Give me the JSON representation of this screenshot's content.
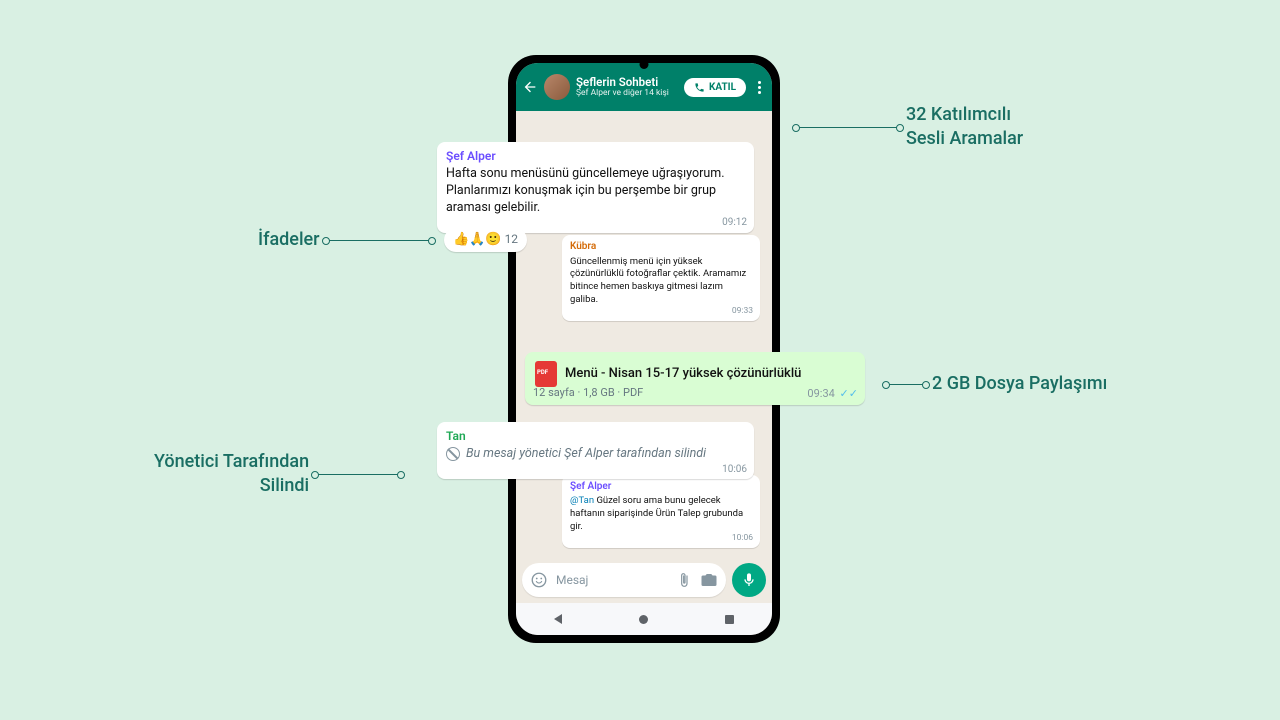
{
  "header": {
    "title": "Şeflerin Sohbeti",
    "subtitle": "Şef Alper ve diğer 14 kişi",
    "join_label": "KATIL"
  },
  "messages": {
    "m1_sender": "Şef Alper",
    "m1_text": "Hafta sonu menüsünü güncellemeye uğraşıyorum. Planlarımızı konuşmak için bu perşembe bir grup araması gelebilir.",
    "m1_time": "09:12",
    "reactions": "👍🙏🙂",
    "reactions_count": "12",
    "m2_sender": "Kübra",
    "m2_text": "Güncellenmiş menü için yüksek çözünürlüklü fotoğraflar çektik. Aramamız bitince hemen baskıya gitmesi lazım galiba.",
    "m2_time": "09:33",
    "file_name": "Menü - Nisan 15-17 yüksek çözünürlüklü",
    "file_meta": "12 sayfa · 1,8 GB · PDF",
    "file_time": "09:34",
    "m4_sender": "Tan",
    "m4_text": "Bu mesaj yönetici Şef Alper tarafından silindi",
    "m4_time": "10:06",
    "m5_sender": "Şef Alper",
    "m5_mention": "@Tan",
    "m5_text": " Güzel soru ama bunu gelecek haftanın siparişinde Ürün Talep grubunda gir.",
    "m5_time": "10:06"
  },
  "input": {
    "placeholder": "Mesaj"
  },
  "callouts": {
    "reactions": "İfadeler",
    "deleted": "Yönetici Tarafından\nSilindi",
    "voice": "32 Katılımcılı\nSesli Aramalar",
    "file": "2 GB Dosya Paylaşımı"
  }
}
